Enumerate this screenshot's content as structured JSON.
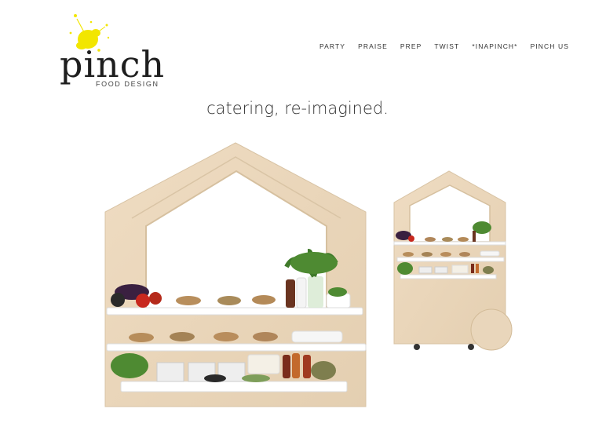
{
  "brand": {
    "name": "pinch",
    "subtitle": "FOOD DESIGN",
    "splash_color": "#f2e600"
  },
  "nav": {
    "items": [
      "PARTY",
      "PRAISE",
      "PREP",
      "TWIST",
      "*INAPINCH*",
      "PINCH US"
    ]
  },
  "tagline": "catering, re-imagined.",
  "hero": {
    "image_alt": "Wooden house-shaped catering carts with food shelves"
  },
  "colors": {
    "wood": "#ead7bd",
    "shelf": "#ffffff",
    "text": "#333333"
  }
}
